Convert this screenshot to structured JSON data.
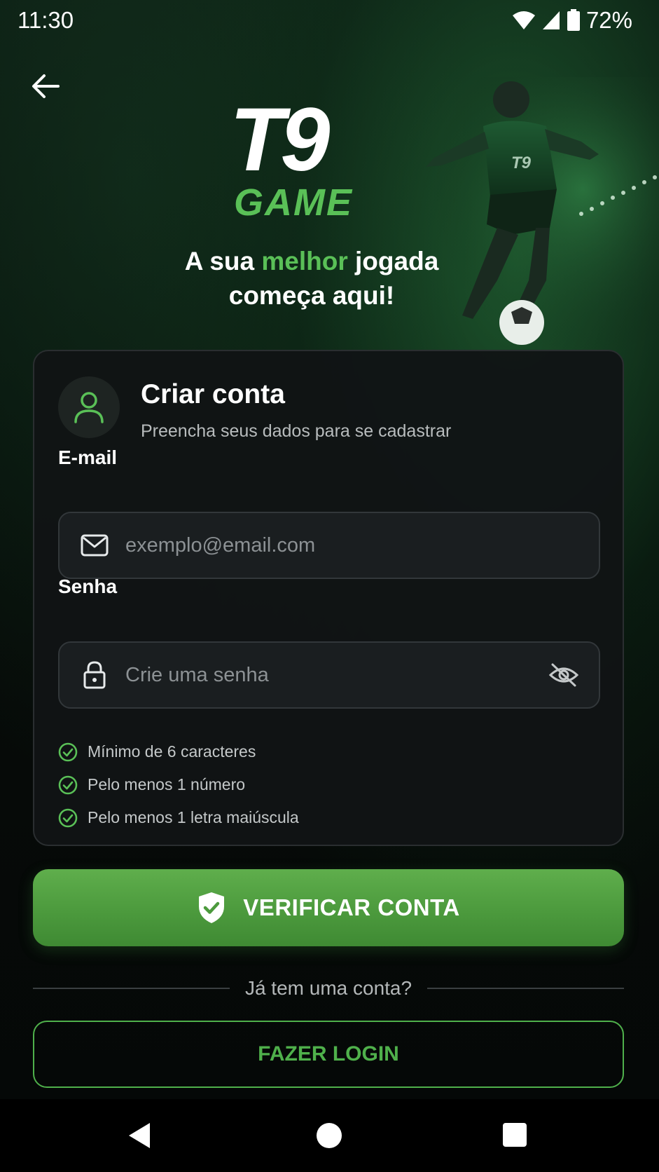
{
  "status_bar": {
    "time": "11:30",
    "battery": "72%",
    "icons": [
      "wifi-icon",
      "signal-icon",
      "battery-icon"
    ]
  },
  "header": {
    "back_icon": "arrow-left-icon"
  },
  "brand": {
    "logo_main": "T9",
    "logo_sub": "GAME",
    "accent_color": "#5ac057"
  },
  "tagline": {
    "before": "A sua ",
    "highlight": "melhor",
    "after": " jogada",
    "line2": "começa aqui!"
  },
  "card": {
    "icon": "user-icon",
    "title": "Criar conta",
    "subtitle": "Preencha seus dados para se cadastrar",
    "email": {
      "label": "E-mail",
      "placeholder": "exemplo@email.com",
      "value": "",
      "icon": "mail-icon"
    },
    "password": {
      "label": "Senha",
      "placeholder": "Crie uma senha",
      "value": "",
      "icon": "lock-icon",
      "toggle_icon": "eye-off-icon"
    },
    "rules": [
      {
        "text": "Mínimo de 6 caracteres",
        "icon": "check-circle-icon"
      },
      {
        "text": "Pelo menos 1 número",
        "icon": "check-circle-icon"
      },
      {
        "text": "Pelo menos 1 letra maiúscula",
        "icon": "check-circle-icon"
      }
    ]
  },
  "actions": {
    "verify_label": "VERIFICAR CONTA",
    "verify_icon": "shield-check-icon",
    "divider_text": "Já tem uma conta?",
    "login_label": "FAZER LOGIN"
  },
  "nav_bar": {
    "icons": [
      "nav-back-icon",
      "nav-home-icon",
      "nav-recents-icon"
    ]
  },
  "colors": {
    "background": "#050807",
    "card": "#111415",
    "primary": "#4fb04b",
    "field": "#1a1e20"
  }
}
